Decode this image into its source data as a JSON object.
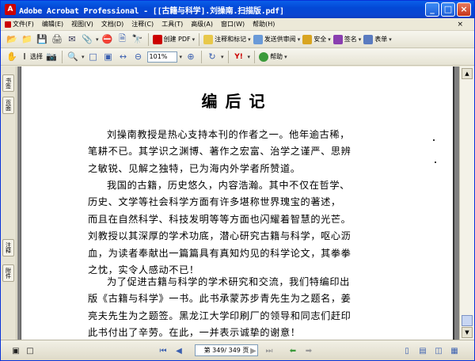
{
  "window": {
    "title": "Adobe Acrobat Professional - [[古籍与科学].刘操南.扫描版.pdf]",
    "minimize_label": "_",
    "maximize_label": "□",
    "close_label": "×"
  },
  "menu": {
    "items": [
      "文件(F)",
      "编辑(E)",
      "视图(V)",
      "文档(D)",
      "注释(C)",
      "工具(T)",
      "高级(A)",
      "窗口(W)",
      "帮助(H)"
    ],
    "close_doc": "×"
  },
  "toolbar1": {
    "create_pdf": "创建 PDF",
    "comment_markup": "注释和标记",
    "send_review": "发送供审阅",
    "security": "安全",
    "sign": "签名",
    "forms": "表单"
  },
  "toolbar2": {
    "select_label": "选择",
    "zoom_value": "101%",
    "help_label": "帮助"
  },
  "nav_tabs": {
    "bookmarks": "书签",
    "pages": "页面",
    "comments": "注释",
    "attachments": "附件"
  },
  "document": {
    "title": "编后记",
    "paragraphs": [
      [
        "刘操南教授是热心支持本刊的作者之一。他年逾古稀，",
        "笔耕不已。其学识之渊博、著作之宏富、治学之谨严、思辨",
        "之敏锐、见解之独特，已为海内外学者所赞道。"
      ],
      [
        "我国的古籍，历史悠久，内容浩瀚。其中不仅在哲学、",
        "历史、文学等社会科学方面有许多堪称世界瑰宝的著述，",
        "而且在自然科学、科技发明等等方面也闪耀着智慧的光芒。",
        "刘教授以其深厚的学术功底，潜心研究古籍与科学，呕心沥",
        "血，为读者奉献出一篇篇具有真知灼见的科学论文，其拳拳",
        "之忱，实令人感动不已！"
      ],
      [
        "为了促进古籍与科学的学术研究和交流，我们特编印出",
        "版《古籍与科学》一书。此书承蒙苏步青先生为之题名，姜",
        "亮夫先生为之题签。黑龙江大学印刷厂的领导和同志们赶印",
        "此书付出了辛劳。在此，一并表示诚挚的谢意！"
      ]
    ]
  },
  "statusbar": {
    "page_indicator": "第 349/ 349 页"
  }
}
